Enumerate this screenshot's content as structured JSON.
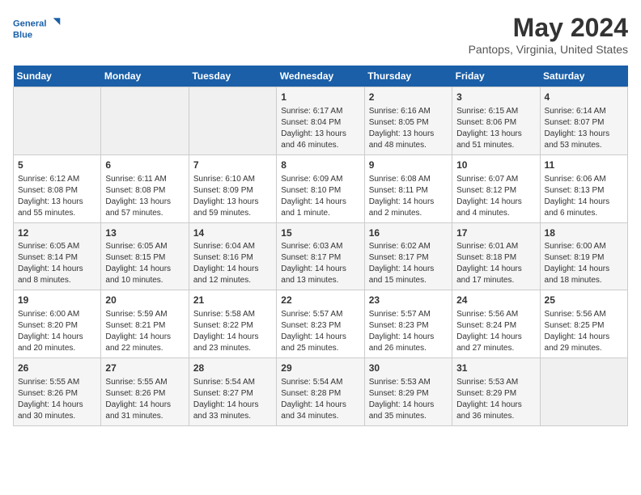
{
  "logo": {
    "line1": "General",
    "line2": "Blue"
  },
  "title": "May 2024",
  "subtitle": "Pantops, Virginia, United States",
  "days_of_week": [
    "Sunday",
    "Monday",
    "Tuesday",
    "Wednesday",
    "Thursday",
    "Friday",
    "Saturday"
  ],
  "weeks": [
    [
      {
        "day": "",
        "info": ""
      },
      {
        "day": "",
        "info": ""
      },
      {
        "day": "",
        "info": ""
      },
      {
        "day": "1",
        "info": "Sunrise: 6:17 AM\nSunset: 8:04 PM\nDaylight: 13 hours\nand 46 minutes."
      },
      {
        "day": "2",
        "info": "Sunrise: 6:16 AM\nSunset: 8:05 PM\nDaylight: 13 hours\nand 48 minutes."
      },
      {
        "day": "3",
        "info": "Sunrise: 6:15 AM\nSunset: 8:06 PM\nDaylight: 13 hours\nand 51 minutes."
      },
      {
        "day": "4",
        "info": "Sunrise: 6:14 AM\nSunset: 8:07 PM\nDaylight: 13 hours\nand 53 minutes."
      }
    ],
    [
      {
        "day": "5",
        "info": "Sunrise: 6:12 AM\nSunset: 8:08 PM\nDaylight: 13 hours\nand 55 minutes."
      },
      {
        "day": "6",
        "info": "Sunrise: 6:11 AM\nSunset: 8:08 PM\nDaylight: 13 hours\nand 57 minutes."
      },
      {
        "day": "7",
        "info": "Sunrise: 6:10 AM\nSunset: 8:09 PM\nDaylight: 13 hours\nand 59 minutes."
      },
      {
        "day": "8",
        "info": "Sunrise: 6:09 AM\nSunset: 8:10 PM\nDaylight: 14 hours\nand 1 minute."
      },
      {
        "day": "9",
        "info": "Sunrise: 6:08 AM\nSunset: 8:11 PM\nDaylight: 14 hours\nand 2 minutes."
      },
      {
        "day": "10",
        "info": "Sunrise: 6:07 AM\nSunset: 8:12 PM\nDaylight: 14 hours\nand 4 minutes."
      },
      {
        "day": "11",
        "info": "Sunrise: 6:06 AM\nSunset: 8:13 PM\nDaylight: 14 hours\nand 6 minutes."
      }
    ],
    [
      {
        "day": "12",
        "info": "Sunrise: 6:05 AM\nSunset: 8:14 PM\nDaylight: 14 hours\nand 8 minutes."
      },
      {
        "day": "13",
        "info": "Sunrise: 6:05 AM\nSunset: 8:15 PM\nDaylight: 14 hours\nand 10 minutes."
      },
      {
        "day": "14",
        "info": "Sunrise: 6:04 AM\nSunset: 8:16 PM\nDaylight: 14 hours\nand 12 minutes."
      },
      {
        "day": "15",
        "info": "Sunrise: 6:03 AM\nSunset: 8:17 PM\nDaylight: 14 hours\nand 13 minutes."
      },
      {
        "day": "16",
        "info": "Sunrise: 6:02 AM\nSunset: 8:17 PM\nDaylight: 14 hours\nand 15 minutes."
      },
      {
        "day": "17",
        "info": "Sunrise: 6:01 AM\nSunset: 8:18 PM\nDaylight: 14 hours\nand 17 minutes."
      },
      {
        "day": "18",
        "info": "Sunrise: 6:00 AM\nSunset: 8:19 PM\nDaylight: 14 hours\nand 18 minutes."
      }
    ],
    [
      {
        "day": "19",
        "info": "Sunrise: 6:00 AM\nSunset: 8:20 PM\nDaylight: 14 hours\nand 20 minutes."
      },
      {
        "day": "20",
        "info": "Sunrise: 5:59 AM\nSunset: 8:21 PM\nDaylight: 14 hours\nand 22 minutes."
      },
      {
        "day": "21",
        "info": "Sunrise: 5:58 AM\nSunset: 8:22 PM\nDaylight: 14 hours\nand 23 minutes."
      },
      {
        "day": "22",
        "info": "Sunrise: 5:57 AM\nSunset: 8:23 PM\nDaylight: 14 hours\nand 25 minutes."
      },
      {
        "day": "23",
        "info": "Sunrise: 5:57 AM\nSunset: 8:23 PM\nDaylight: 14 hours\nand 26 minutes."
      },
      {
        "day": "24",
        "info": "Sunrise: 5:56 AM\nSunset: 8:24 PM\nDaylight: 14 hours\nand 27 minutes."
      },
      {
        "day": "25",
        "info": "Sunrise: 5:56 AM\nSunset: 8:25 PM\nDaylight: 14 hours\nand 29 minutes."
      }
    ],
    [
      {
        "day": "26",
        "info": "Sunrise: 5:55 AM\nSunset: 8:26 PM\nDaylight: 14 hours\nand 30 minutes."
      },
      {
        "day": "27",
        "info": "Sunrise: 5:55 AM\nSunset: 8:26 PM\nDaylight: 14 hours\nand 31 minutes."
      },
      {
        "day": "28",
        "info": "Sunrise: 5:54 AM\nSunset: 8:27 PM\nDaylight: 14 hours\nand 33 minutes."
      },
      {
        "day": "29",
        "info": "Sunrise: 5:54 AM\nSunset: 8:28 PM\nDaylight: 14 hours\nand 34 minutes."
      },
      {
        "day": "30",
        "info": "Sunrise: 5:53 AM\nSunset: 8:29 PM\nDaylight: 14 hours\nand 35 minutes."
      },
      {
        "day": "31",
        "info": "Sunrise: 5:53 AM\nSunset: 8:29 PM\nDaylight: 14 hours\nand 36 minutes."
      },
      {
        "day": "",
        "info": ""
      }
    ]
  ]
}
